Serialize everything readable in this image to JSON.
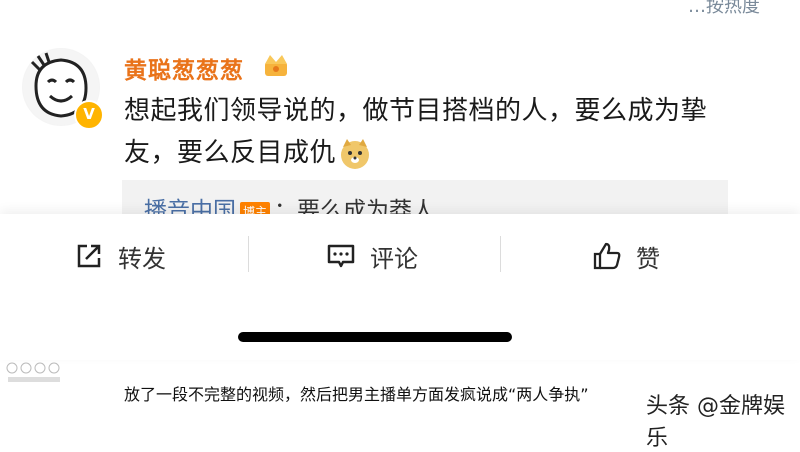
{
  "top_hint": "…按热度",
  "post": {
    "username": "黄聪葱葱葱",
    "text": "想起我们领导说的，做节目搭档的人，要么成为挚友，要么反目成仇",
    "quote_user": "播音中国",
    "quote_tag": "博主",
    "quote_text": "：要么成为莽人"
  },
  "actions": {
    "repost": "转发",
    "comment": "评论",
    "like": "赞"
  },
  "caption": "放了一段不完整的视频，然后把男主播单方面发疯说成“两人争执”",
  "watermark": "头条 @金牌娱乐",
  "colors": {
    "username": "#e9731a",
    "badge": "#ffb400",
    "link": "#4a6fa5",
    "tag": "#ff8200"
  }
}
